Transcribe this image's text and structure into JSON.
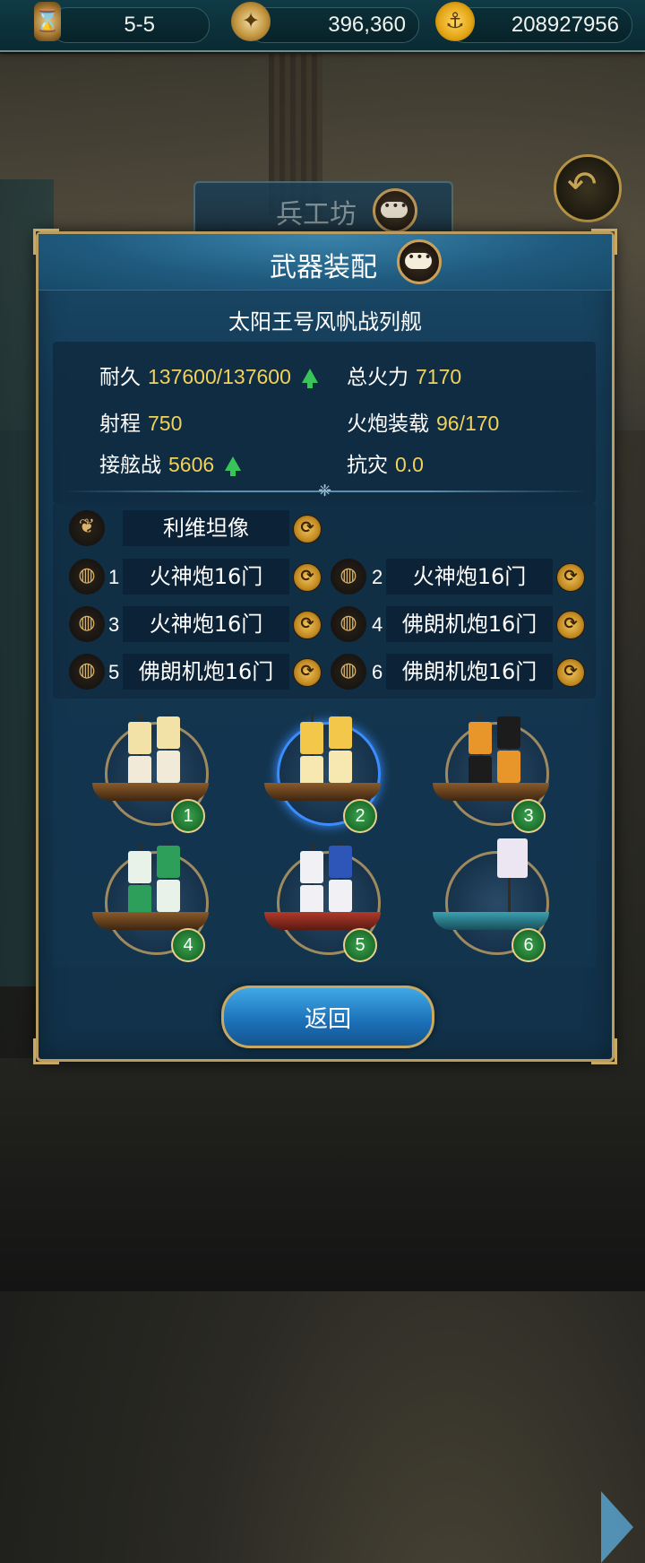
{
  "topbar": {
    "level": "5-5",
    "compass_value": "396,360",
    "gold_value": "208927956",
    "icons": [
      "hourglass-icon",
      "compass-icon",
      "anchor-coin-icon"
    ]
  },
  "workshop_tab": {
    "label": "兵工坊"
  },
  "panel": {
    "title": "武器装配",
    "ship_name": "太阳王号风帆战列舰",
    "stats": {
      "durability_label": "耐久",
      "durability_value": "137600/137600",
      "firepower_label": "总火力",
      "firepower_value": "7170",
      "range_label": "射程",
      "range_value": "750",
      "cannon_load_label": "火炮装载",
      "cannon_load_value": "96/170",
      "boarding_label": "接舷战",
      "boarding_value": "5606",
      "disaster_label": "抗灾",
      "disaster_value": "0.0"
    },
    "figurehead": {
      "label": "利维坦像"
    },
    "cannon_slots": [
      {
        "num": "1",
        "label": "火神炮16门"
      },
      {
        "num": "2",
        "label": "火神炮16门"
      },
      {
        "num": "3",
        "label": "火神炮16门"
      },
      {
        "num": "4",
        "label": "佛朗机炮16门"
      },
      {
        "num": "5",
        "label": "佛朗机炮16门"
      },
      {
        "num": "6",
        "label": "佛朗机炮16门"
      }
    ],
    "fleet": [
      {
        "badge": "1",
        "selected": false
      },
      {
        "badge": "2",
        "selected": true
      },
      {
        "badge": "3",
        "selected": false
      },
      {
        "badge": "4",
        "selected": false
      },
      {
        "badge": "5",
        "selected": false
      },
      {
        "badge": "6",
        "selected": false
      }
    ],
    "return_button": "返回"
  },
  "colors": {
    "accent_gold": "#f1d25a",
    "panel_blue": "#1a4a69",
    "badge_green": "#2f8f42",
    "frame_gold": "#b99c62"
  }
}
